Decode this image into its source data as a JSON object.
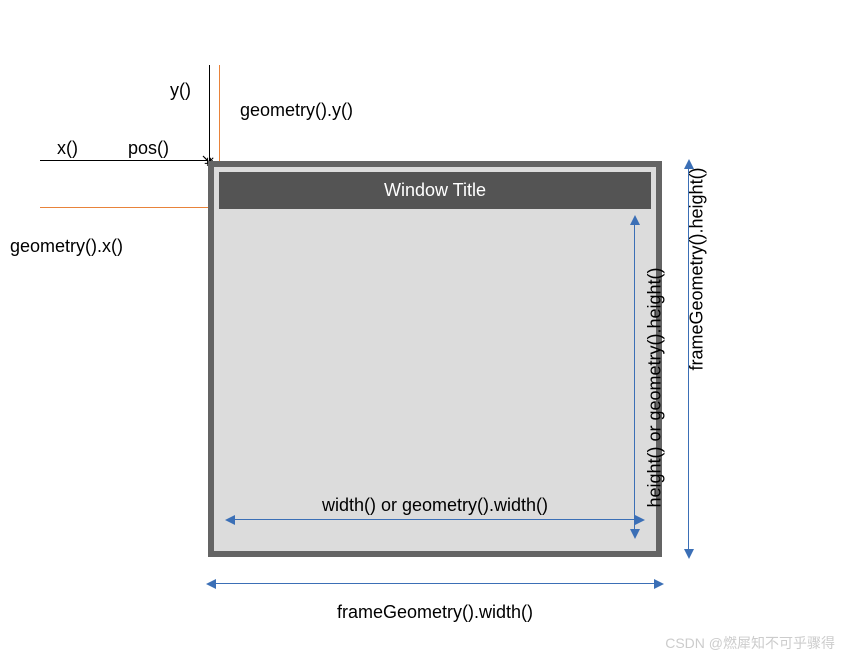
{
  "labels": {
    "y": "y()",
    "geom_y": "geometry().y()",
    "x": "x()",
    "pos": "pos()",
    "geom_x": "geometry().x()",
    "window_title": "Window Title",
    "inner_width": "width() or geometry().width()",
    "inner_height": "height() or geometry().height()",
    "frame_width": "frameGeometry().width()",
    "frame_height": "frameGeometry().height()"
  },
  "watermark": "CSDN @燃犀知不可乎骤得",
  "colors": {
    "frame_border": "#646464",
    "titlebar": "#545454",
    "client_bg": "#dcdcdc",
    "orange": "#e8833a",
    "blue": "#3b6fb6"
  }
}
